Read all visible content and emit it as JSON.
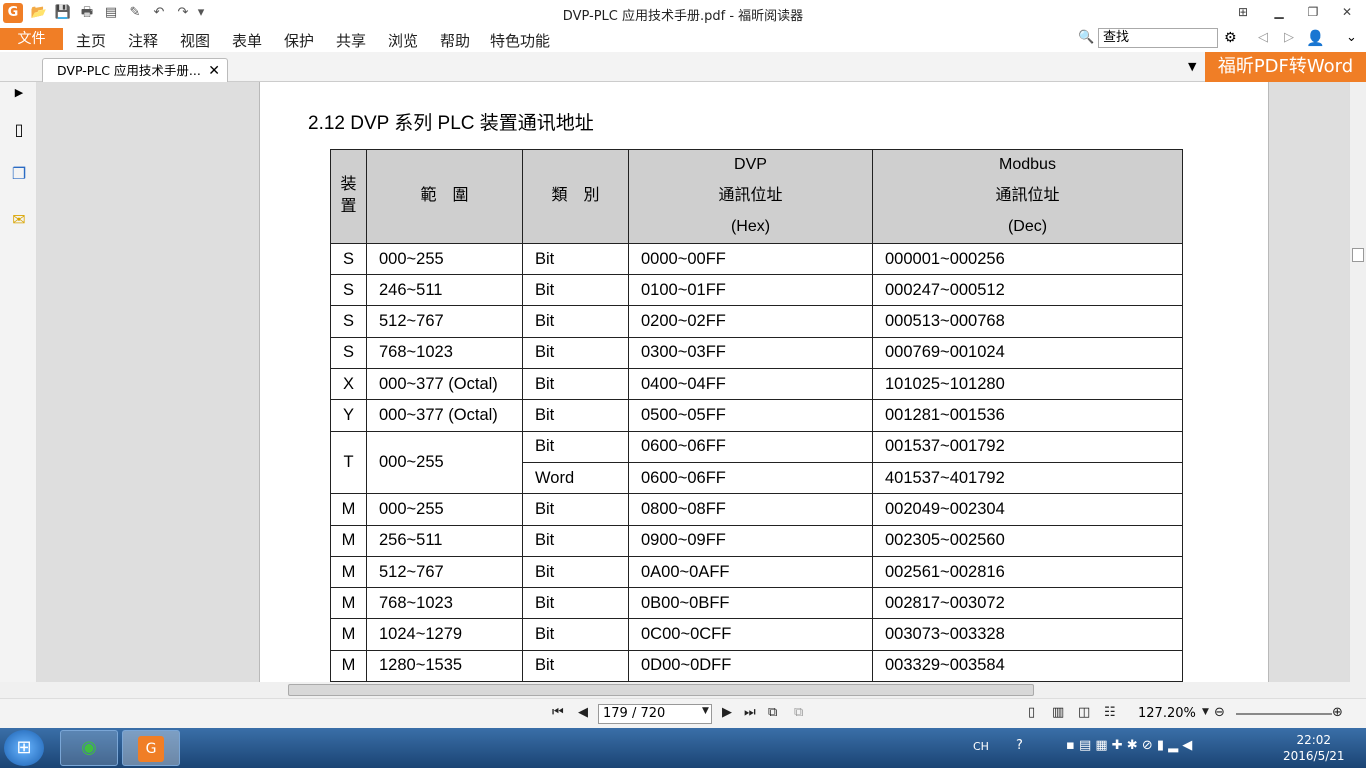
{
  "window": {
    "title": "DVP-PLC 应用技术手册.pdf - 福昕阅读器"
  },
  "menu": {
    "file": "文件",
    "items": [
      "主页",
      "注释",
      "视图",
      "表单",
      "保护",
      "共享",
      "浏览",
      "帮助",
      "特色功能"
    ],
    "search_placeholder": "查找"
  },
  "tab": {
    "label": "DVP-PLC 应用技术手册...",
    "close": "✕"
  },
  "banner": "福昕PDF转Word",
  "page": {
    "section_title": "2.12 DVP 系列 PLC 装置通讯地址"
  },
  "table": {
    "headers": {
      "device": "装置",
      "range": "範　圍",
      "type": "類　別",
      "dvp_line1": "DVP",
      "dvp_line2": "通訊位址",
      "dvp_line3": "(Hex)",
      "modbus_line1": "Modbus",
      "modbus_line2": "通訊位址",
      "modbus_line3": "(Dec)"
    },
    "rows": [
      {
        "device": "S",
        "range": "000~255",
        "type": "Bit",
        "dvp": "0000~00FF",
        "modbus": "000001~000256"
      },
      {
        "device": "S",
        "range": "246~511",
        "type": "Bit",
        "dvp": "0100~01FF",
        "modbus": "000247~000512"
      },
      {
        "device": "S",
        "range": "512~767",
        "type": "Bit",
        "dvp": "0200~02FF",
        "modbus": "000513~000768"
      },
      {
        "device": "S",
        "range": "768~1023",
        "type": "Bit",
        "dvp": "0300~03FF",
        "modbus": "000769~001024"
      },
      {
        "device": "X",
        "range": "000~377 (Octal)",
        "type": "Bit",
        "dvp": "0400~04FF",
        "modbus": "101025~101280"
      },
      {
        "device": "Y",
        "range": "000~377 (Octal)",
        "type": "Bit",
        "dvp": "0500~05FF",
        "modbus": "001281~001536"
      },
      {
        "device": "T",
        "range": "000~255",
        "type": "Bit",
        "dvp": "0600~06FF",
        "modbus": "001537~001792"
      },
      {
        "device": "",
        "range": "",
        "type": "Word",
        "dvp": "0600~06FF",
        "modbus": "401537~401792"
      },
      {
        "device": "M",
        "range": "000~255",
        "type": "Bit",
        "dvp": "0800~08FF",
        "modbus": "002049~002304"
      },
      {
        "device": "M",
        "range": "256~511",
        "type": "Bit",
        "dvp": "0900~09FF",
        "modbus": "002305~002560"
      },
      {
        "device": "M",
        "range": "512~767",
        "type": "Bit",
        "dvp": "0A00~0AFF",
        "modbus": "002561~002816"
      },
      {
        "device": "M",
        "range": "768~1023",
        "type": "Bit",
        "dvp": "0B00~0BFF",
        "modbus": "002817~003072"
      },
      {
        "device": "M",
        "range": "1024~1279",
        "type": "Bit",
        "dvp": "0C00~0CFF",
        "modbus": "003073~003328"
      },
      {
        "device": "M",
        "range": "1280~1535",
        "type": "Bit",
        "dvp": "0D00~0DFF",
        "modbus": "003329~003584"
      }
    ]
  },
  "status": {
    "page_indicator": "179 / 720",
    "zoom": "127.20%"
  },
  "taskbar": {
    "lang": "CH",
    "time": "22:02",
    "date": "2016/5/21"
  }
}
